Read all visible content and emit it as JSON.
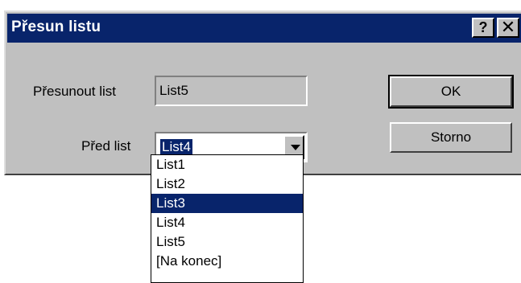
{
  "window": {
    "title": "Přesun listu",
    "help_icon": "?",
    "close_icon": "✕"
  },
  "form": {
    "move_label": "Přesunout list",
    "move_value": "List5",
    "before_label": "Před list",
    "before_selected": "List4"
  },
  "buttons": {
    "ok": "OK",
    "cancel": "Storno"
  },
  "dropdown": {
    "options": [
      "List1",
      "List2",
      "List3",
      "List4",
      "List5",
      "[Na konec]"
    ],
    "highlighted": "List3"
  },
  "colors": {
    "titlebar": "#08246b",
    "dialog": "#c0c0c0",
    "highlight": "#08246b"
  }
}
